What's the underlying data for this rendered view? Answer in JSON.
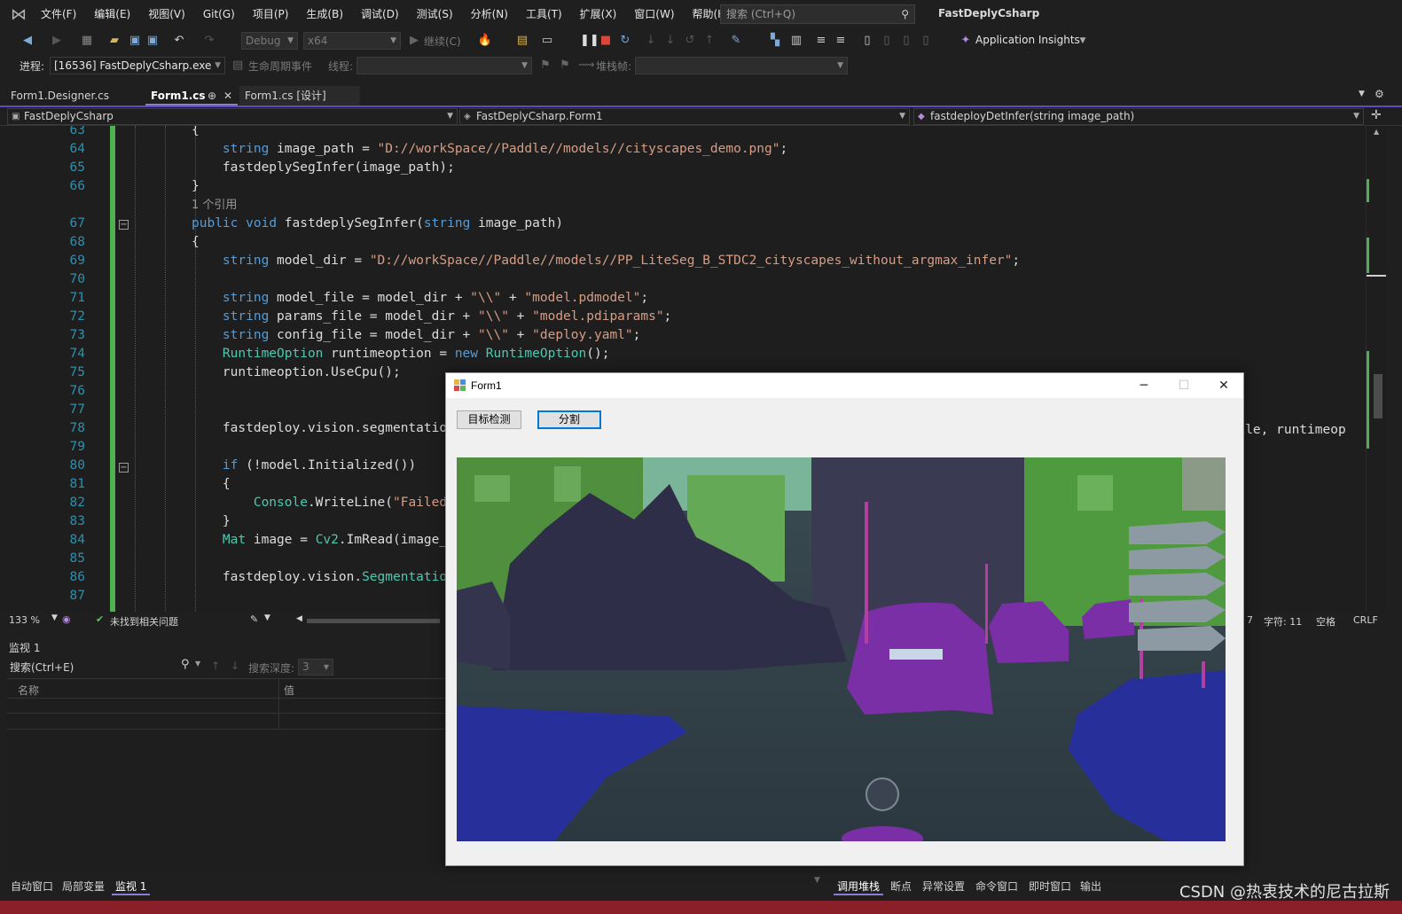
{
  "app": {
    "title": "FastDeplyCsharp",
    "menu": [
      "文件(F)",
      "编辑(E)",
      "视图(V)",
      "Git(G)",
      "项目(P)",
      "生成(B)",
      "调试(D)",
      "测试(S)",
      "分析(N)",
      "工具(T)",
      "扩展(X)",
      "窗口(W)",
      "帮助(H)"
    ],
    "search_placeholder": "搜索 (Ctrl+Q)"
  },
  "toolbar": {
    "config": "Debug",
    "platform": "x64",
    "continue_label": "继续(C)",
    "app_insights": "Application Insights",
    "process_label": "进程:",
    "process_value": "[16536] FastDeplyCsharp.exe",
    "lifecycle_label": "生命周期事件",
    "thread_label": "线程:",
    "stack_label": "堆栈帧:"
  },
  "tabs": [
    {
      "label": "Form1.Designer.cs",
      "active": false
    },
    {
      "label": "Form1.cs",
      "active": true
    },
    {
      "label": "Form1.cs [设计]",
      "active": false
    }
  ],
  "navbar": {
    "project": "FastDeplyCsharp",
    "class": "FastDeplyCsharp.Form1",
    "member": "fastdeployDetInfer(string image_path)"
  },
  "code_lines": [
    {
      "n": "63",
      "text": "{"
    },
    {
      "n": "64",
      "text": "    string image_path = \"D://workSpace//Paddle//models//cityscapes_demo.png\";"
    },
    {
      "n": "65",
      "text": "    fastdeplySegInfer(image_path);"
    },
    {
      "n": "66",
      "text": "}"
    },
    {
      "n": "",
      "text": "1 个引用",
      "refs": true
    },
    {
      "n": "67",
      "text": "public void fastdeplySegInfer(string image_path)"
    },
    {
      "n": "68",
      "text": "{"
    },
    {
      "n": "69",
      "text": "    string model_dir = \"D://workSpace//Paddle//models//PP_LiteSeg_B_STDC2_cityscapes_without_argmax_infer\";"
    },
    {
      "n": "70",
      "text": ""
    },
    {
      "n": "71",
      "text": "    string model_file = model_dir + \"\\\\\" + \"model.pdmodel\";"
    },
    {
      "n": "72",
      "text": "    string params_file = model_dir + \"\\\\\" + \"model.pdiparams\";"
    },
    {
      "n": "73",
      "text": "    string config_file = model_dir + \"\\\\\" + \"deploy.yaml\";"
    },
    {
      "n": "74",
      "text": "    RuntimeOption runtimeoption = new RuntimeOption();"
    },
    {
      "n": "75",
      "text": "    runtimeoption.UseCpu();"
    },
    {
      "n": "76",
      "text": ""
    },
    {
      "n": "77",
      "text": ""
    },
    {
      "n": "78",
      "text": "    fastdeploy.vision.segmentation"
    },
    {
      "n": "79",
      "text": ""
    },
    {
      "n": "80",
      "text": "    if (!model.Initialized())"
    },
    {
      "n": "81",
      "text": "    {"
    },
    {
      "n": "82",
      "text": "        Console.WriteLine(\"Failed"
    },
    {
      "n": "83",
      "text": "    }"
    },
    {
      "n": "84",
      "text": "    Mat image = Cv2.ImRead(image_"
    },
    {
      "n": "85",
      "text": ""
    },
    {
      "n": "86",
      "text": "    fastdeploy.vision.Segmentation"
    },
    {
      "n": "87",
      "text": ""
    }
  ],
  "line78_tail": "_file, runtimeop",
  "editor_status": {
    "zoom": "133 %",
    "issues": "未找到相关问题",
    "line_frag": "7",
    "char": "字符: 11",
    "space": "空格",
    "eol": "CRLF"
  },
  "watch": {
    "title": "监视 1",
    "search_placeholder": "搜索(Ctrl+E)",
    "depth_label": "搜索深度:",
    "depth_value": "3",
    "col_name": "名称",
    "col_value": "值"
  },
  "bottom_tabs_left": [
    "自动窗口",
    "局部变量",
    "监视 1"
  ],
  "bottom_tabs_right": [
    "调用堆栈",
    "断点",
    "异常设置",
    "命令窗口",
    "即时窗口",
    "输出"
  ],
  "watermark": "CSDN @热衷技术的尼古拉斯",
  "form": {
    "title": "Form1",
    "btn_detect": "目标检测",
    "btn_segment": "分割",
    "minimize": "─",
    "maximize": "☐",
    "close": "✕"
  },
  "colors": {
    "keyword": "#569cd6",
    "string": "#d69d85",
    "type": "#4ec9b0",
    "accent": "#5c4bc2",
    "status_bar": "#8a1f2a"
  }
}
